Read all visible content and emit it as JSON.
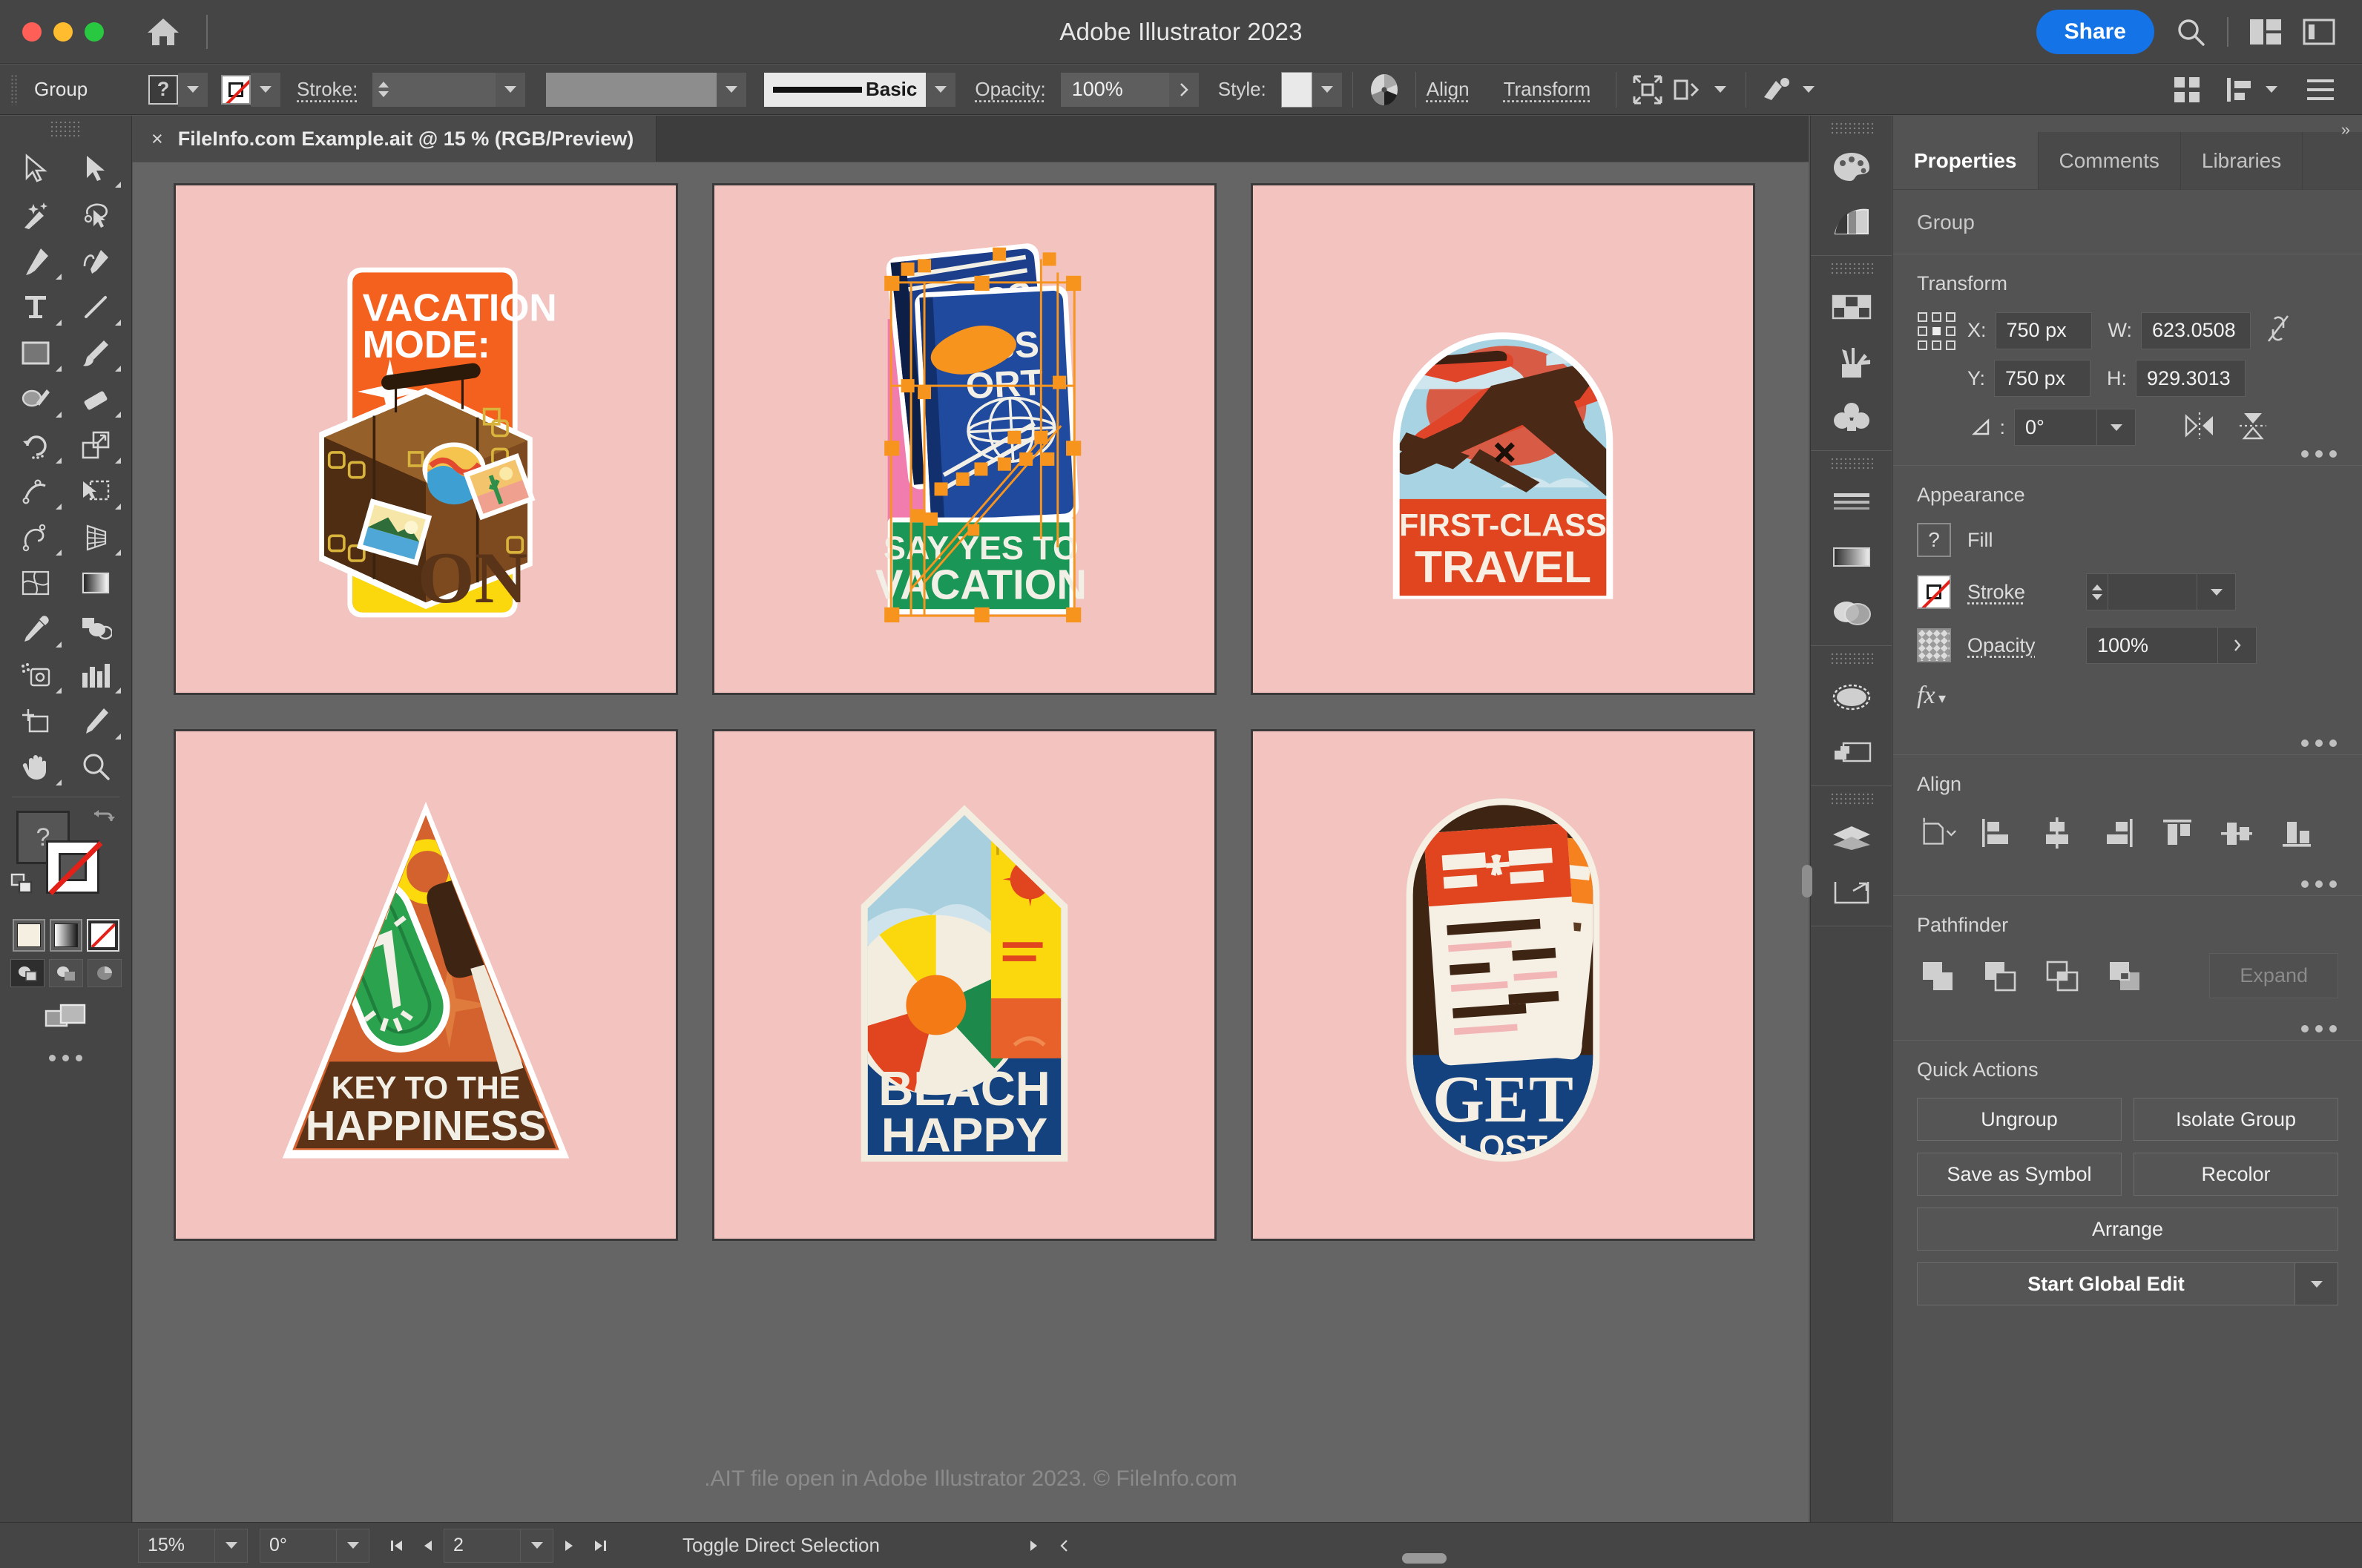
{
  "window": {
    "app_title": "Adobe Illustrator 2023",
    "home_icon": "home-icon",
    "share_label": "Share",
    "search_icon": "search-icon",
    "arrange_icon": "arrange-documents-icon",
    "workspace_icon": "workspace-switcher-icon",
    "traffic_colors": {
      "close": "#ff5f57",
      "minimize": "#febc2e",
      "zoom": "#28c840"
    },
    "accent_blue": "#1473e6"
  },
  "controlbar": {
    "object_label": "Group",
    "fill_swatch_glyph": "?",
    "stroke_label": "Stroke:",
    "stroke_weight": "",
    "brush_name": "Basic",
    "opacity_label": "Opacity:",
    "opacity_value": "100%",
    "style_label": "Style:",
    "recolor_icon": "recolor-artwork-icon",
    "align_label": "Align",
    "transform_label": "Transform",
    "select_similar_icon": "select-similar-objects-icon",
    "isolate_icon": "isolation-mode-icon",
    "document_setup_icon": "document-setup-icon",
    "arrange_grid_icon": "arrange-grid-icon",
    "distribute_icon": "distribute-icon",
    "list_icon": "list-view-icon"
  },
  "document": {
    "tab_title": "FileInfo.com Example.ait @ 15 % (RGB/Preview)",
    "close_glyph": "×"
  },
  "toolbar": {
    "tools": [
      {
        "name": "selection-tool",
        "selected": false
      },
      {
        "name": "direct-selection-tool",
        "selected": false
      },
      {
        "name": "magic-wand-tool",
        "selected": false
      },
      {
        "name": "lasso-tool",
        "selected": false
      },
      {
        "name": "pen-tool",
        "selected": false
      },
      {
        "name": "curvature-tool",
        "selected": false
      },
      {
        "name": "type-tool",
        "selected": false
      },
      {
        "name": "line-segment-tool",
        "selected": false
      },
      {
        "name": "rectangle-tool",
        "selected": false
      },
      {
        "name": "paintbrush-tool",
        "selected": false
      },
      {
        "name": "shaper-tool",
        "selected": false
      },
      {
        "name": "eraser-tool",
        "selected": false
      },
      {
        "name": "rotate-tool",
        "selected": false
      },
      {
        "name": "scale-tool",
        "selected": false
      },
      {
        "name": "width-tool",
        "selected": false
      },
      {
        "name": "free-transform-tool",
        "selected": false
      },
      {
        "name": "shape-builder-tool",
        "selected": false
      },
      {
        "name": "perspective-grid-tool",
        "selected": false
      },
      {
        "name": "mesh-tool",
        "selected": false
      },
      {
        "name": "gradient-tool",
        "selected": false
      },
      {
        "name": "eyedropper-tool",
        "selected": false
      },
      {
        "name": "blend-tool",
        "selected": false
      },
      {
        "name": "symbol-sprayer-tool",
        "selected": false
      },
      {
        "name": "column-graph-tool",
        "selected": false
      },
      {
        "name": "artboard-tool",
        "selected": false
      },
      {
        "name": "slice-tool",
        "selected": false
      },
      {
        "name": "hand-tool",
        "selected": false
      },
      {
        "name": "zoom-tool",
        "selected": false
      }
    ],
    "fill_glyph": "?",
    "stroke_state": "none",
    "swatch_modes": [
      "color-swatch",
      "gradient-swatch",
      "none-swatch"
    ],
    "draw_modes": [
      "draw-normal",
      "draw-behind",
      "draw-inside"
    ],
    "screen_mode": "change-screen-mode-icon",
    "more_tools": "edit-toolbar-icon"
  },
  "canvas": {
    "background": "#656565",
    "artboard_fill": "#f2c3bf",
    "watermark": ".AIT file open in Adobe Illustrator 2023. © FileInfo.com",
    "stickers": [
      {
        "id": "vacation-mode-on",
        "line1": "VACATION",
        "line2": "MODE:",
        "line3": "ON",
        "selected": false
      },
      {
        "id": "say-yes-to-vacation",
        "line1": "PASSPORT",
        "line2": "SAY YES TO",
        "line3": "VACATION",
        "selected": true
      },
      {
        "id": "first-class-travel",
        "line1": "FIRST-CLASS",
        "line2": "TRAVEL",
        "selected": false
      },
      {
        "id": "key-to-the-happiness",
        "line1": "KEY TO THE",
        "line2": "HAPPINESS",
        "selected": false
      },
      {
        "id": "beach-happy",
        "line1": "BEACH",
        "line2": "HAPPY",
        "selected": false
      },
      {
        "id": "get-lost",
        "line1": "GET",
        "line2": "LOST",
        "selected": false
      }
    ],
    "selection_color": "#f7941e"
  },
  "rail": {
    "groups": [
      [
        "color-panel-icon",
        "color-guide-panel-icon"
      ],
      [
        "swatches-panel-icon",
        "brushes-panel-icon",
        "symbols-panel-icon"
      ],
      [
        "stroke-panel-icon",
        "gradient-panel-icon",
        "transparency-panel-icon"
      ],
      [
        "appearance-panel-icon",
        "graphic-styles-panel-icon"
      ],
      [
        "layers-panel-icon",
        "artboards-panel-icon"
      ]
    ]
  },
  "panel": {
    "tabs": [
      {
        "label": "Properties",
        "active": true
      },
      {
        "label": "Comments",
        "active": false
      },
      {
        "label": "Libraries",
        "active": false
      }
    ],
    "object_name": "Group",
    "transform": {
      "title": "Transform",
      "reference_point_icon": "reference-point-grid-icon",
      "x_label": "X:",
      "x_value": "750 px",
      "y_label": "Y:",
      "y_value": "750 px",
      "w_label": "W:",
      "w_value": "623.0508",
      "h_label": "H:",
      "h_value": "929.3013",
      "link_icon": "constrain-proportions-unlinked-icon",
      "angle_label": "∠:",
      "angle_value": "0°",
      "flip_h_icon": "flip-horizontal-icon",
      "flip_v_icon": "flip-vertical-icon",
      "more_icon": "more-options-icon"
    },
    "appearance": {
      "title": "Appearance",
      "fill_label": "Fill",
      "fill_glyph": "?",
      "stroke_label": "Stroke",
      "stroke_weight": "",
      "opacity_label": "Opacity",
      "opacity_value": "100%",
      "fx_label": "fx",
      "more_icon": "more-options-icon"
    },
    "align": {
      "title": "Align",
      "buttons": [
        "align-to-selection-icon",
        "horizontal-align-left-icon",
        "horizontal-align-center-icon",
        "horizontal-align-right-icon",
        "vertical-align-top-icon",
        "vertical-align-center-icon",
        "vertical-align-bottom-icon"
      ],
      "more_icon": "more-options-icon"
    },
    "pathfinder": {
      "title": "Pathfinder",
      "buttons": [
        "unite-icon",
        "minus-front-icon",
        "intersect-icon",
        "exclude-icon"
      ],
      "expand_label": "Expand",
      "more_icon": "more-options-icon"
    },
    "quick_actions": {
      "title": "Quick Actions",
      "buttons": [
        "Ungroup",
        "Isolate Group",
        "Save as Symbol",
        "Recolor",
        "Arrange"
      ],
      "global_edit_label": "Start Global Edit",
      "global_edit_dd": "chevron-down-icon"
    }
  },
  "statusbar": {
    "zoom_value": "15%",
    "rotate_value": "0°",
    "artboard_value": "2",
    "status_text": "Toggle Direct Selection",
    "first_icon": "first-artboard-icon",
    "prev_icon": "previous-artboard-icon",
    "next_icon": "next-artboard-icon",
    "last_icon": "last-artboard-icon"
  }
}
